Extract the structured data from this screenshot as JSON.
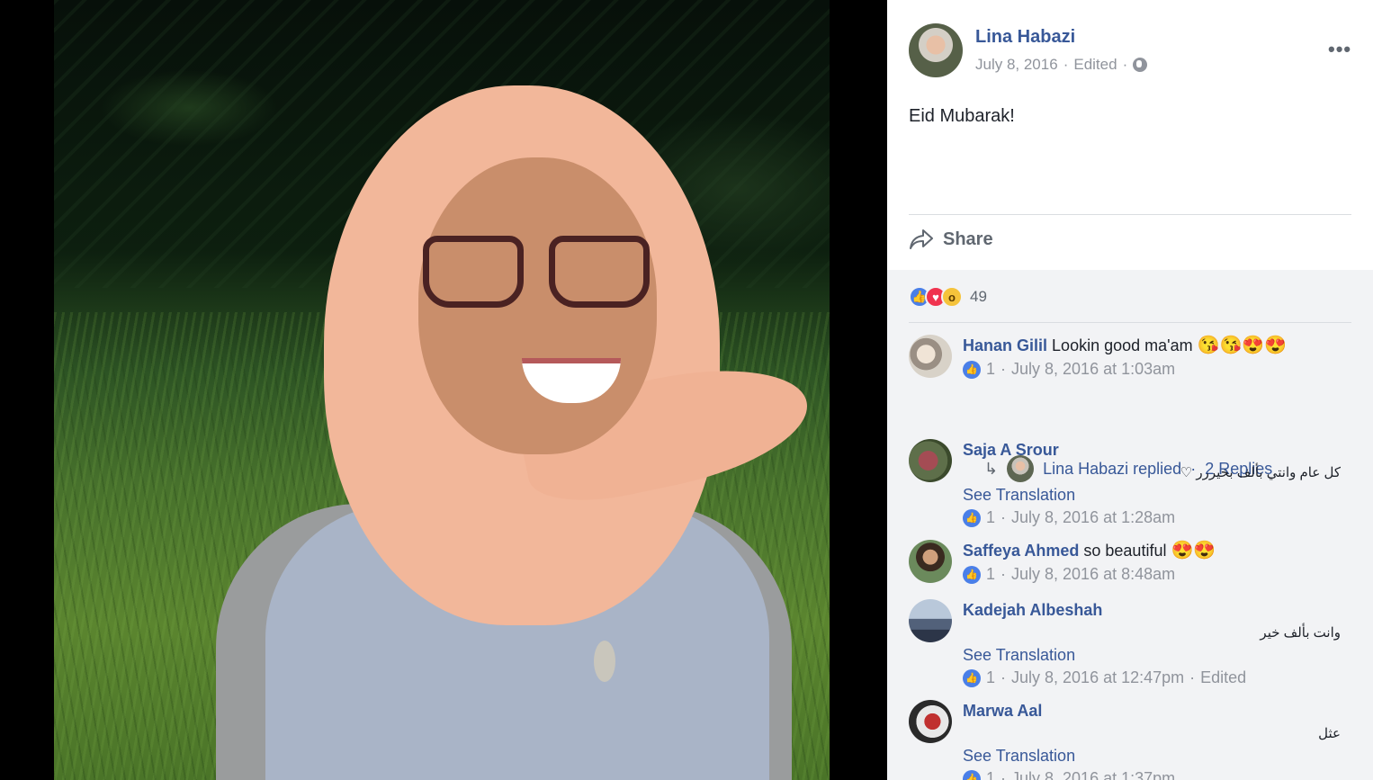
{
  "post": {
    "author": "Lina Habazi",
    "date": "July 8, 2016",
    "edited": "Edited",
    "text": "Eid Mubarak!",
    "share_label": "Share",
    "reaction_count": "49"
  },
  "comments": [
    {
      "name": "Hanan Gilil",
      "text": "Lookin good ma'am",
      "emojis": "😘😘😍😍",
      "likes": "1",
      "time": "July 8, 2016 at 1:03am",
      "reply_author": "Lina Habazi replied",
      "reply_count": "2 Replies"
    },
    {
      "name": "Saja A Srour",
      "text": "كل عام وانتي بألف بخيررر ♡",
      "see_translation": "See Translation",
      "likes": "1",
      "time": "July 8, 2016 at 1:28am"
    },
    {
      "name": "Saffeya Ahmed",
      "text": "so beautiful",
      "emojis": "😍😍",
      "likes": "1",
      "time": "July 8, 2016 at 8:48am"
    },
    {
      "name": "Kadejah Albeshah",
      "text": "وانت بألف خير",
      "see_translation": "See Translation",
      "likes": "1",
      "time": "July 8, 2016 at 12:47pm",
      "edited": "Edited"
    },
    {
      "name": "Marwa Aal",
      "text": "عثل",
      "see_translation": "See Translation",
      "likes": "1",
      "time": "July 8, 2016 at 1:37pm"
    }
  ],
  "colors": {
    "link": "#385898",
    "meta": "#90949c",
    "like": "#4a7fe8",
    "love": "#f0334f",
    "comments_bg": "#f2f3f5"
  }
}
